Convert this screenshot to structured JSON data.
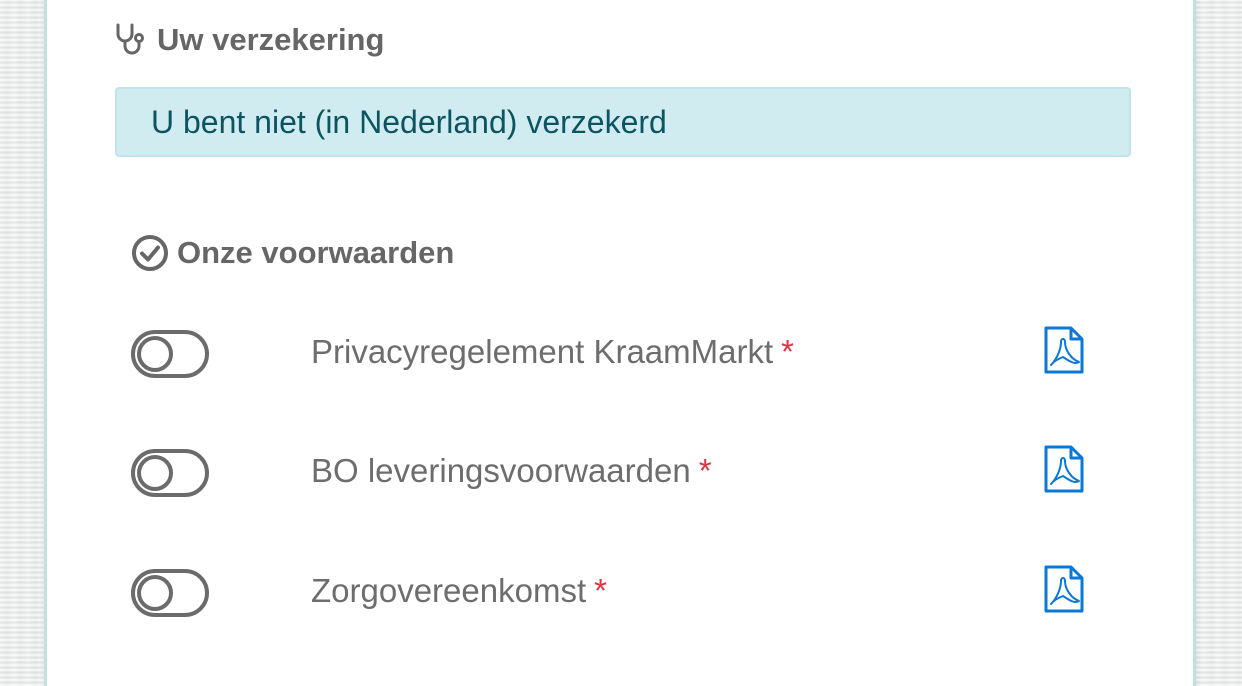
{
  "insurance": {
    "title": "Uw verzekering",
    "icon": "stethoscope-icon",
    "status_message": "U bent niet (in Nederland) verzekerd"
  },
  "conditions": {
    "title": "Onze voorwaarden",
    "icon": "check-circle-icon",
    "items": [
      {
        "label": "Privacyregelement KraamMarkt",
        "required_marker": "*",
        "toggle_on": false,
        "document_icon": "pdf-icon"
      },
      {
        "label": "BO leveringsvoorwaarden",
        "required_marker": "*",
        "toggle_on": false,
        "document_icon": "pdf-icon"
      },
      {
        "label": "Zorgovereenkomst",
        "required_marker": "*",
        "toggle_on": false,
        "document_icon": "pdf-icon"
      }
    ]
  },
  "colors": {
    "alert_background": "#d1ecf1",
    "alert_text": "#0c5460",
    "required": "#dc3545",
    "pdf_icon": "#0a78d7",
    "card_border": "#bfe3dc"
  }
}
